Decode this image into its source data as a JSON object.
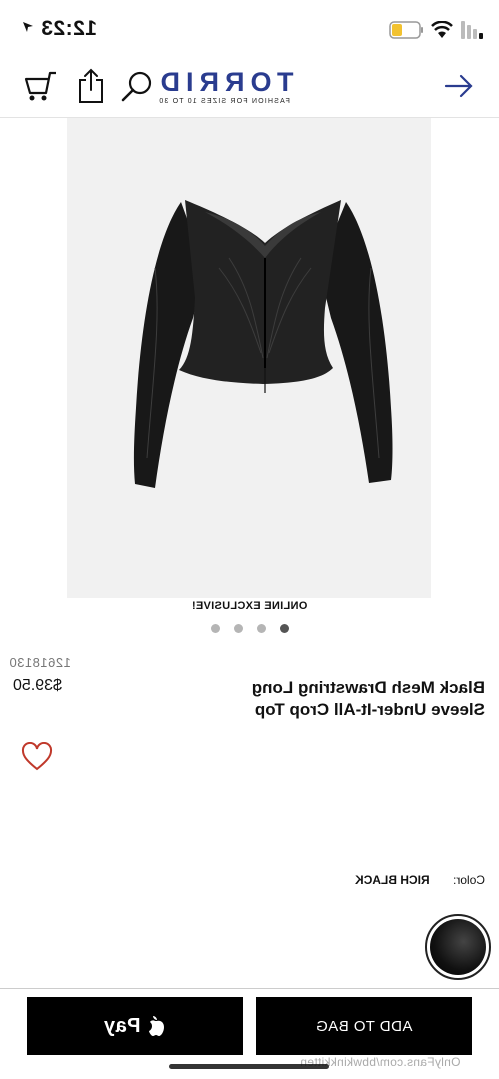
{
  "status_bar": {
    "time": "12:23",
    "icons": [
      "location-arrow-icon",
      "signal-icon",
      "wifi-icon",
      "battery-icon"
    ]
  },
  "navbar": {
    "back_icon": "arrow-icon",
    "logo_text": "TORRID",
    "logo_tagline": "FASHION FOR SIZES 10 TO 30",
    "actions": [
      "search-icon",
      "share-icon",
      "cart-icon"
    ]
  },
  "product": {
    "image_alt": "Black mesh drawstring long sleeve crop top",
    "badge": "ONLINE EXCLUSIVE!",
    "carousel": {
      "count": 4,
      "active_index": 0
    },
    "title": "Black Mesh Drawstring Long Sleeve Under-It-All Crop Top",
    "sku": "12618130",
    "price": "$39.50",
    "color_label": "Color:",
    "color_value": "RICH BLACK"
  },
  "actions": {
    "add_to_bag": "ADD TO BAG",
    "apple_pay": "Pay"
  },
  "watermark": "OnlyFans.com/bbwkinkkitten",
  "colors": {
    "logo_primary": "#2a3c8f",
    "accent_heart": "#c0392b",
    "button": "#000000"
  }
}
